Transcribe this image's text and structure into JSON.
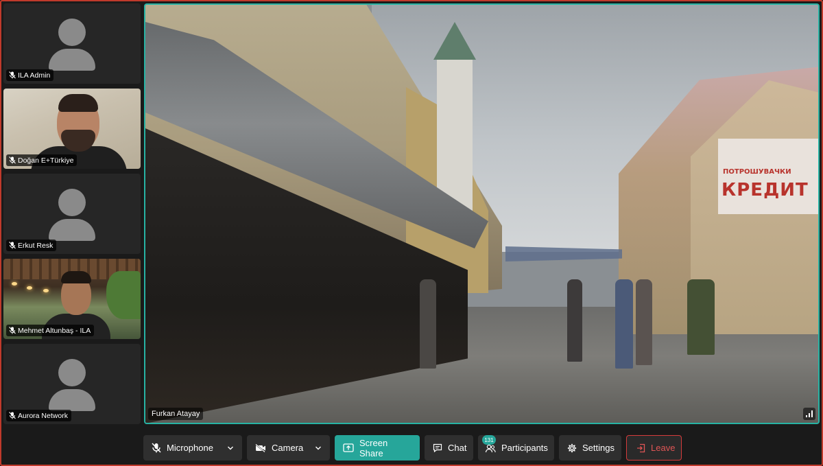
{
  "participants_tiles": [
    {
      "name": "ILA Admin",
      "has_video": false
    },
    {
      "name": "Doğan E+Türkiye",
      "has_video": true
    },
    {
      "name": "Erkut Resk",
      "has_video": false
    },
    {
      "name": "Mehmet Altunbaş - ILA",
      "has_video": true
    },
    {
      "name": "Aurora Network",
      "has_video": false
    }
  ],
  "main_video": {
    "speaker_name": "Furkan Atayay",
    "sign_top": "ПОТРОШУВАЧКИ",
    "sign_main": "КРЕДИТ"
  },
  "toolbar": {
    "microphone_label": "Microphone",
    "camera_label": "Camera",
    "screen_share_label": "Screen Share",
    "chat_label": "Chat",
    "participants_label": "Participants",
    "participants_count": "131",
    "settings_label": "Settings",
    "leave_label": "Leave"
  },
  "colors": {
    "accent": "#26a69a",
    "active_speaker_border": "#27b3a4",
    "leave": "#d63b3b",
    "tile_bg": "#262626",
    "app_bg": "#1a1a1a"
  }
}
